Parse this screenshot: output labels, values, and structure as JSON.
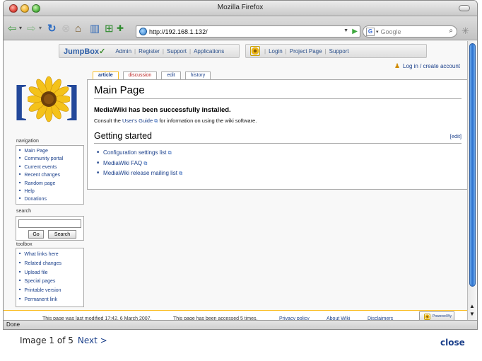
{
  "window": {
    "title": "Mozilla Firefox"
  },
  "toolbar": {
    "url": "http://192.168.1.132/",
    "search_placeholder": "Google"
  },
  "jumpbox_bar": {
    "logo": "JumpBox",
    "links": [
      "Admin",
      "Register",
      "Support",
      "Applications"
    ]
  },
  "app_bar": {
    "links": [
      "Login",
      "Project Page",
      "Support"
    ]
  },
  "user": {
    "login_link": "Log in / create account"
  },
  "tabs": [
    {
      "label": "article"
    },
    {
      "label": "discussion"
    },
    {
      "label": "edit"
    },
    {
      "label": "history"
    }
  ],
  "article": {
    "title": "Main Page",
    "success": "MediaWiki has been successfully installed.",
    "consult_prefix": "Consult the ",
    "consult_link": "User's Guide",
    "consult_suffix": " for information on using the wiki software.",
    "section_title": "Getting started",
    "edit_link": "[edit]",
    "links": [
      "Configuration settings list",
      "MediaWiki FAQ",
      "MediaWiki release mailing list"
    ]
  },
  "navigation": {
    "title": "navigation",
    "items": [
      "Main Page",
      "Community portal",
      "Current events",
      "Recent changes",
      "Random page",
      "Help",
      "Donations"
    ]
  },
  "search": {
    "title": "search",
    "go": "Go",
    "search": "Search"
  },
  "toolbox": {
    "title": "toolbox",
    "items": [
      "What links here",
      "Related changes",
      "Upload file",
      "Special pages",
      "Printable version",
      "Permanent link"
    ]
  },
  "footer": {
    "modified": "This page was last modified 17:42, 6 March 2007.",
    "accessed": "This page has been accessed 5 times.",
    "privacy": "Privacy policy",
    "about": "About Wiki",
    "disclaimers": "Disclaimers",
    "powered": "Powered By"
  },
  "status": {
    "text": "Done"
  },
  "gallery": {
    "counter": "Image 1 of 5",
    "next": "Next >",
    "close": "close"
  },
  "colors": {
    "link": "#1a3f8a",
    "accent": "#fabd23",
    "bracket": "#23489a"
  }
}
